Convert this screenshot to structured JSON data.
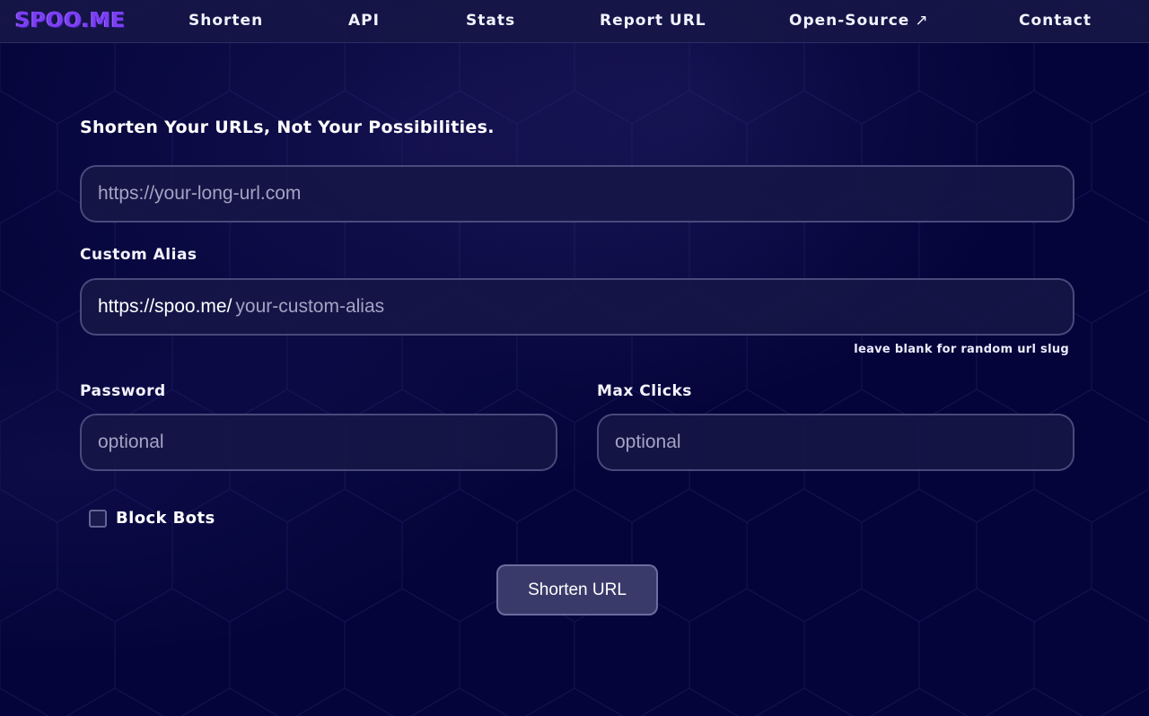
{
  "nav": {
    "logo": "SPOO.ME",
    "links": [
      {
        "label": "Shorten"
      },
      {
        "label": "API"
      },
      {
        "label": "Stats"
      },
      {
        "label": "Report URL"
      },
      {
        "label": "Open-Source",
        "icon": "↗"
      },
      {
        "label": "Contact"
      }
    ]
  },
  "form": {
    "headline": "Shorten Your URLs, Not Your Possibilities.",
    "url_placeholder": "https://your-long-url.com",
    "alias_label": "Custom Alias",
    "alias_prefix": "https://spoo.me/",
    "alias_placeholder": "your-custom-alias",
    "alias_hint": "leave blank for random url slug",
    "password_label": "Password",
    "password_placeholder": "optional",
    "max_clicks_label": "Max Clicks",
    "max_clicks_placeholder": "optional",
    "block_bots_label": "Block Bots",
    "submit_label": "Shorten URL"
  },
  "colors": {
    "background": "#04043a",
    "brand": "#7b3ff2"
  }
}
